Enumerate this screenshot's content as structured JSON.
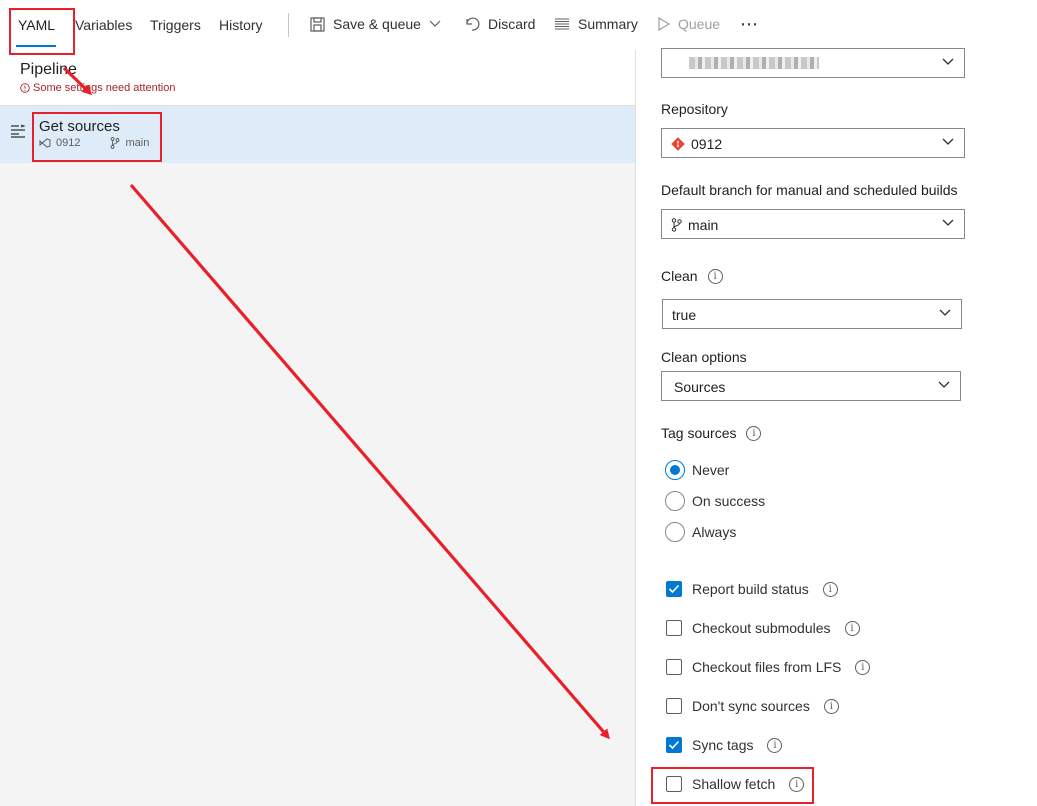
{
  "toolbar": {
    "tabs": [
      "YAML",
      "Variables",
      "Triggers",
      "History"
    ],
    "save_queue": "Save & queue",
    "discard": "Discard",
    "summary": "Summary",
    "queue": "Queue",
    "more": "⋯"
  },
  "left": {
    "pipeline_title": "Pipeline",
    "warning": "Some settings need attention",
    "task": {
      "name": "Get sources",
      "repo": "0912",
      "branch": "main"
    }
  },
  "right": {
    "repository_label": "Repository",
    "repository_value": "0912",
    "branch_label": "Default branch for manual and scheduled builds",
    "branch_value": "main",
    "clean_label": "Clean",
    "clean_value": "true",
    "clean_options_label": "Clean options",
    "clean_options_value": "Sources",
    "tag_sources_label": "Tag sources",
    "tag_options": [
      {
        "label": "Never",
        "selected": true
      },
      {
        "label": "On success",
        "selected": false
      },
      {
        "label": "Always",
        "selected": false
      }
    ],
    "checkboxes": [
      {
        "label": "Report build status",
        "checked": true
      },
      {
        "label": "Checkout submodules",
        "checked": false
      },
      {
        "label": "Checkout files from LFS",
        "checked": false
      },
      {
        "label": "Don't sync sources",
        "checked": false
      },
      {
        "label": "Sync tags",
        "checked": true
      },
      {
        "label": "Shallow fetch",
        "checked": false
      }
    ]
  },
  "colors": {
    "accent": "#0078d4",
    "annotation": "#e8202a",
    "warning": "#a4262c",
    "selected_row": "#deecf9"
  }
}
